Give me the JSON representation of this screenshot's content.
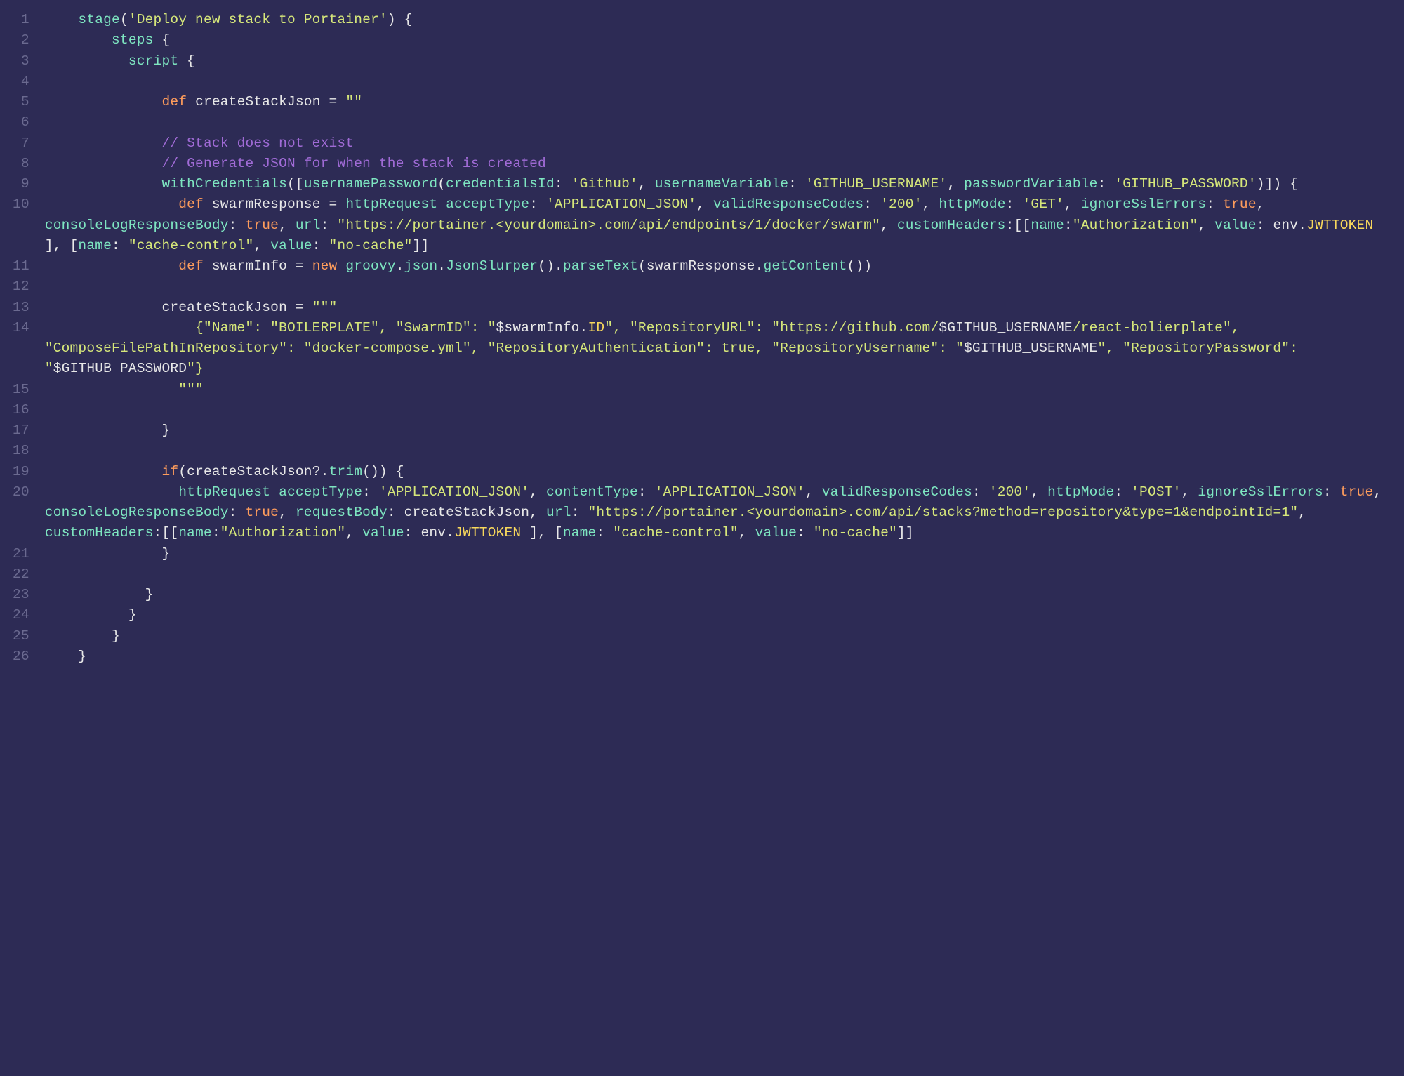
{
  "lines": [
    {
      "n": "1",
      "html": "    <span class='fn'>stage</span><span class='p'>(</span><span class='str'>'Deploy new stack to Portainer'</span><span class='p'>)</span> <span class='p'>{</span>"
    },
    {
      "n": "2",
      "html": "        <span class='fn'>steps</span> <span class='p'>{</span>"
    },
    {
      "n": "3",
      "html": "          <span class='fn'>script</span> <span class='p'>{</span>"
    },
    {
      "n": "4",
      "html": ""
    },
    {
      "n": "5",
      "html": "              <span class='kw'>def</span> <span class='id'>createStackJson</span> <span class='p'>=</span> <span class='str'>\"\"</span>"
    },
    {
      "n": "6",
      "html": ""
    },
    {
      "n": "7",
      "html": "              <span class='cm'>// Stack does not exist</span>"
    },
    {
      "n": "8",
      "html": "              <span class='cm'>// Generate JSON for when the stack is created</span>"
    },
    {
      "n": "9",
      "html": "              <span class='fn'>withCredentials</span><span class='p'>([</span><span class='fn'>usernamePassword</span><span class='p'>(</span><span class='attr'>credentialsId</span><span class='p'>:</span> <span class='str'>'Github'</span><span class='p'>,</span> <span class='attr'>usernameVariable</span><span class='p'>:</span> <span class='str'>'GITHUB_USERNAME'</span><span class='p'>,</span> <span class='attr'>passwordVariable</span><span class='p'>:</span> <span class='str'>'GITHUB_PASSWORD'</span><span class='p'>)]) {</span>"
    },
    {
      "n": "10",
      "html": "                <span class='kw'>def</span> <span class='id'>swarmResponse</span> <span class='p'>=</span> <span class='fn'>httpRequest</span> <span class='attr'>acceptType</span><span class='p'>:</span> <span class='str'>'APPLICATION_JSON'</span><span class='p'>,</span> <span class='attr'>validResponseCodes</span><span class='p'>:</span> <span class='str'>'200'</span><span class='p'>,</span> <span class='attr'>httpMode</span><span class='p'>:</span> <span class='str'>'GET'</span><span class='p'>,</span> <span class='attr'>ignoreSslErrors</span><span class='p'>:</span> <span class='kw2'>true</span><span class='p'>,</span> <span class='attr'>consoleLogResponseBody</span><span class='p'>:</span> <span class='kw2'>true</span><span class='p'>,</span> <span class='attr'>url</span><span class='p'>:</span> <span class='str'>\"https://portainer.&lt;yourdomain&gt;.com/api/endpoints/1/docker/swarm\"</span><span class='p'>,</span> <span class='attr'>customHeaders</span><span class='p'>:[[</span><span class='attr'>name</span><span class='p'>:</span><span class='str'>\"Authorization\"</span><span class='p'>,</span> <span class='attr'>value</span><span class='p'>:</span> <span class='id'>env</span><span class='p'>.</span><span class='const'>JWTTOKEN</span> <span class='p'>], [</span><span class='attr'>name</span><span class='p'>:</span> <span class='str'>\"cache-control\"</span><span class='p'>,</span> <span class='attr'>value</span><span class='p'>:</span> <span class='str'>\"no-cache\"</span><span class='p'>]]</span>"
    },
    {
      "n": "11",
      "html": "                <span class='kw'>def</span> <span class='id'>swarmInfo</span> <span class='p'>=</span> <span class='kw'>new</span> <span class='fn'>groovy</span><span class='p'>.</span><span class='fn'>json</span><span class='p'>.</span><span class='fn'>JsonSlurper</span><span class='p'>().</span><span class='fn'>parseText</span><span class='p'>(</span><span class='id'>swarmResponse</span><span class='p'>.</span><span class='fn'>getContent</span><span class='p'>())</span>"
    },
    {
      "n": "12",
      "html": ""
    },
    {
      "n": "13",
      "html": "              <span class='id'>createStackJson</span> <span class='p'>=</span> <span class='str'>\"\"\"</span>"
    },
    {
      "n": "14",
      "html": "<span class='str'>                  {\"Name\": \"BOILERPLATE\", \"SwarmID\": \"</span><span class='id'>$swarmInfo</span><span class='p'>.</span><span class='const'>ID</span><span class='str'>\", \"RepositoryURL\": \"https://github.com/</span><span class='id'>$GITHUB_USERNAME</span><span class='str'>/react-bolierplate\", \"ComposeFilePathInRepository\": \"docker-compose.yml\", \"RepositoryAuthentication\": true, \"RepositoryUsername\": \"</span><span class='id'>$GITHUB_USERNAME</span><span class='str'>\", \"RepositoryPassword\": \"</span><span class='id'>$GITHUB_PASSWORD</span><span class='str'>\"}</span>"
    },
    {
      "n": "15",
      "html": "<span class='str'>                \"\"\"</span>"
    },
    {
      "n": "16",
      "html": ""
    },
    {
      "n": "17",
      "html": "              <span class='p'>}</span>"
    },
    {
      "n": "18",
      "html": ""
    },
    {
      "n": "19",
      "html": "              <span class='kw'>if</span><span class='p'>(</span><span class='id'>createStackJson</span><span class='p'>?.</span><span class='fn'>trim</span><span class='p'>()) {</span>"
    },
    {
      "n": "20",
      "html": "                <span class='fn'>httpRequest</span> <span class='attr'>acceptType</span><span class='p'>:</span> <span class='str'>'APPLICATION_JSON'</span><span class='p'>,</span> <span class='attr'>contentType</span><span class='p'>:</span> <span class='str'>'APPLICATION_JSON'</span><span class='p'>,</span> <span class='attr'>validResponseCodes</span><span class='p'>:</span> <span class='str'>'200'</span><span class='p'>,</span> <span class='attr'>httpMode</span><span class='p'>:</span> <span class='str'>'POST'</span><span class='p'>,</span> <span class='attr'>ignoreSslErrors</span><span class='p'>:</span> <span class='kw2'>true</span><span class='p'>,</span> <span class='attr'>consoleLogResponseBody</span><span class='p'>:</span> <span class='kw2'>true</span><span class='p'>,</span> <span class='attr'>requestBody</span><span class='p'>:</span> <span class='id'>createStackJson</span><span class='p'>,</span> <span class='attr'>url</span><span class='p'>:</span> <span class='str'>\"https://portainer.&lt;yourdomain&gt;.com/api/stacks?method=repository&amp;type=1&amp;endpointId=1\"</span><span class='p'>,</span> <span class='attr'>customHeaders</span><span class='p'>:[[</span><span class='attr'>name</span><span class='p'>:</span><span class='str'>\"Authorization\"</span><span class='p'>,</span> <span class='attr'>value</span><span class='p'>:</span> <span class='id'>env</span><span class='p'>.</span><span class='const'>JWTTOKEN</span> <span class='p'>], [</span><span class='attr'>name</span><span class='p'>:</span> <span class='str'>\"cache-control\"</span><span class='p'>,</span> <span class='attr'>value</span><span class='p'>:</span> <span class='str'>\"no-cache\"</span><span class='p'>]]</span>"
    },
    {
      "n": "21",
      "html": "              <span class='p'>}</span>"
    },
    {
      "n": "22",
      "html": ""
    },
    {
      "n": "23",
      "html": "            <span class='p'>}</span>"
    },
    {
      "n": "24",
      "html": "          <span class='p'>}</span>"
    },
    {
      "n": "25",
      "html": "        <span class='p'>}</span>"
    },
    {
      "n": "26",
      "html": "    <span class='p'>}</span>"
    }
  ]
}
